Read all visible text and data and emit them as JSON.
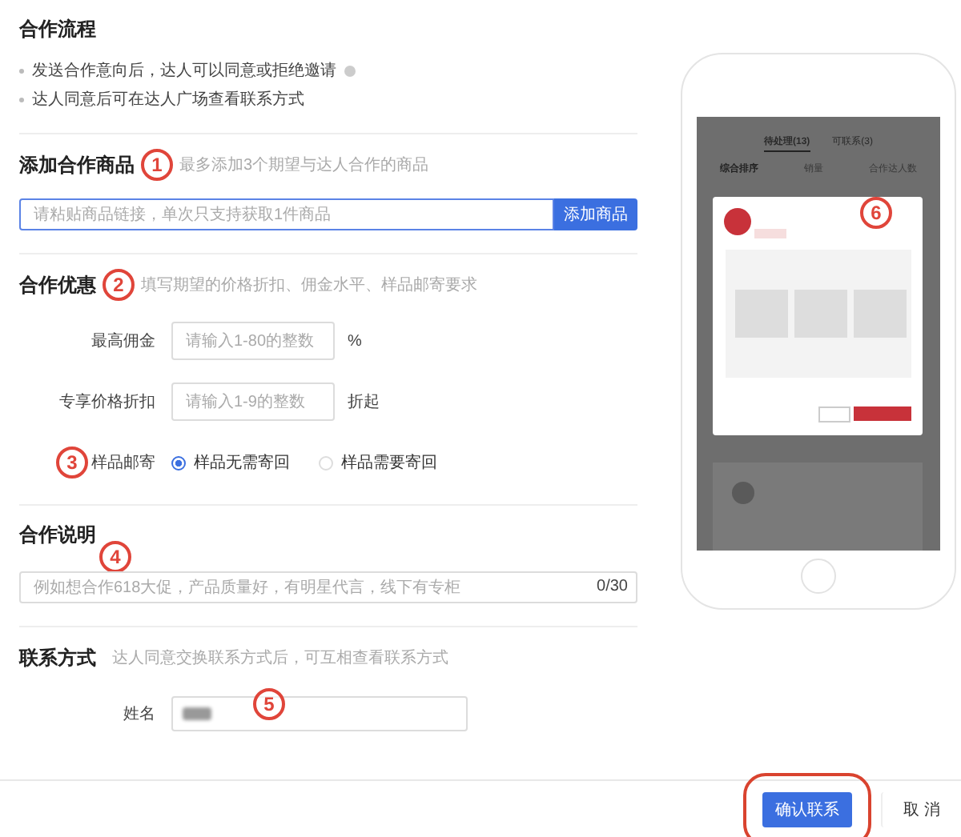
{
  "process": {
    "title": "合作流程",
    "steps": [
      {
        "text": "发送合作意向后，达人可以同意或拒绝邀请",
        "info": true
      },
      {
        "text": "达人同意后可在达人广场查看联系方式",
        "info": false
      }
    ]
  },
  "add_product": {
    "title": "添加合作商品",
    "hint": "最多添加3个期望与达人合作的商品",
    "placeholder": "请粘贴商品链接，单次只支持获取1件商品",
    "button": "添加商品"
  },
  "offer": {
    "title": "合作优惠",
    "hint": "填写期望的价格折扣、佣金水平、样品邮寄要求",
    "fields": [
      {
        "label": "最高佣金",
        "placeholder": "请输入1-80的整数",
        "unit": "%"
      },
      {
        "label": "专享价格折扣",
        "placeholder": "请输入1-9的整数",
        "unit": "折起"
      }
    ],
    "sample": {
      "label": "样品邮寄",
      "options": [
        {
          "label": "样品无需寄回",
          "selected": true
        },
        {
          "label": "样品需要寄回",
          "selected": false
        }
      ]
    }
  },
  "description": {
    "title": "合作说明",
    "placeholder": "例如想合作618大促，产品质量好，有明星代言，线下有专柜",
    "counter": "0/30"
  },
  "contact": {
    "title": "联系方式",
    "hint": "达人同意交换联系方式后，可互相查看联系方式",
    "fields": [
      {
        "label": "姓名",
        "redacted": true
      }
    ]
  },
  "annotations": [
    "1",
    "2",
    "3",
    "4",
    "5",
    "6"
  ],
  "phone": {
    "tabs": [
      {
        "label": "待处理(13)",
        "selected": true
      },
      {
        "label": "可联系(3)",
        "selected": false
      }
    ],
    "sort": [
      {
        "label": "综合排序",
        "selected": true
      },
      {
        "label": "销量",
        "selected": false
      },
      {
        "label": "合作达人数",
        "selected": false
      }
    ]
  },
  "footer": {
    "buttons": [
      {
        "label": "确认联系",
        "kind": "primary",
        "highlighted": true
      },
      {
        "label": "取 消",
        "kind": "plain",
        "highlighted": false
      }
    ]
  }
}
